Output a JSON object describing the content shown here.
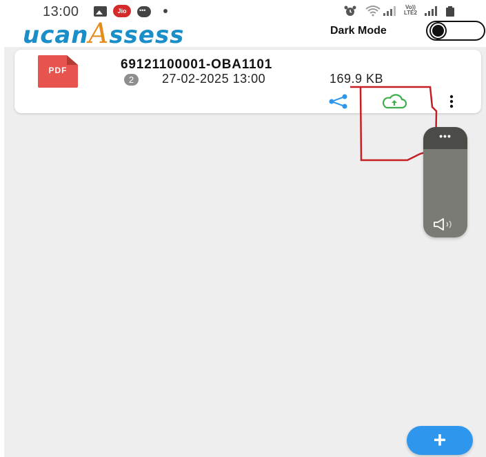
{
  "status_bar": {
    "time": "13:00",
    "jio_label": "Jio",
    "volte_label_top": "Vo))",
    "volte_label_bottom": "LTE2"
  },
  "header": {
    "logo_part1": "ucan",
    "logo_part2": "A",
    "logo_part3": "ssess",
    "dark_mode_label": "Dark Mode",
    "dark_mode_on": false
  },
  "files": [
    {
      "icon_label": "PDF",
      "name": "69121100001-OBA1101",
      "version": "2",
      "date": "27-02-2025 13:00",
      "size": "169.9 KB"
    }
  ],
  "volume_panel": {
    "menu_dots": "•••"
  },
  "fab": {
    "label": "+"
  },
  "colors": {
    "logo_blue": "#1a8ec8",
    "logo_orange": "#e58c1c",
    "pdf_red": "#e7544d",
    "share_blue": "#2f96ee",
    "upload_green": "#3fae4e",
    "annotation_red": "#c51f23",
    "fab_blue": "#2f96ee",
    "background": "#eeeeee"
  },
  "icons": [
    "gallery-icon",
    "jio-icon",
    "chat-icon",
    "alarm-icon",
    "wifi-icon",
    "signal-icon",
    "battery-icon",
    "share-icon",
    "cloud-upload-icon",
    "more-vert-icon",
    "speaker-icon",
    "plus-icon"
  ]
}
